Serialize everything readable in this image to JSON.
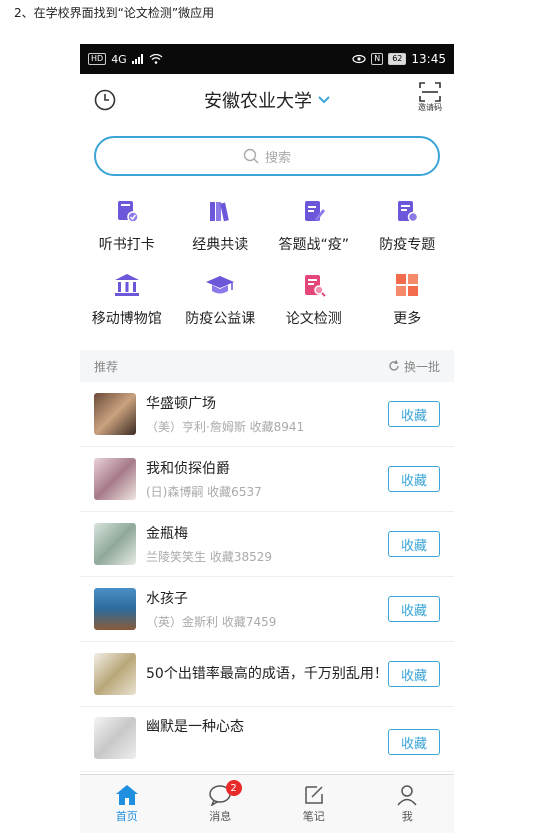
{
  "caption": "2、在学校界面找到“论文检测”微应用",
  "status_bar": {
    "network": "4G",
    "battery": "62",
    "time": "13:45"
  },
  "header": {
    "title": "安徽农业大学",
    "invite_label": "邀请码"
  },
  "search": {
    "placeholder": "搜索"
  },
  "apps": [
    {
      "label": "听书打卡",
      "icon": "audiobook-checkin-icon",
      "color": "#6c56d9"
    },
    {
      "label": "经典共读",
      "icon": "books-icon",
      "color": "#6c56d9"
    },
    {
      "label": "答题战“疫”",
      "icon": "quiz-icon",
      "color": "#6c56d9"
    },
    {
      "label": "防疫专题",
      "icon": "epidemic-topic-icon",
      "color": "#6c56d9"
    },
    {
      "label": "移动博物馆",
      "icon": "museum-icon",
      "color": "#6c56d9"
    },
    {
      "label": "防疫公益课",
      "icon": "graduation-cap-icon",
      "color": "#6c56d9"
    },
    {
      "label": "论文检测",
      "icon": "paper-check-icon",
      "color": "#e5467a"
    },
    {
      "label": "更多",
      "icon": "more-grid-icon",
      "color": "#f26b4a"
    }
  ],
  "recommend": {
    "title": "推荐",
    "refresh_label": "换一批",
    "items": [
      {
        "title": "华盛顿广场",
        "meta": "（美）亨利·詹姆斯  收藏8941",
        "action": "收藏"
      },
      {
        "title": "我和侦探伯爵",
        "meta": "(日)森博嗣  收藏6537",
        "action": "收藏"
      },
      {
        "title": "金瓶梅",
        "meta": "兰陵笑笑生  收藏38529",
        "action": "收藏"
      },
      {
        "title": "水孩子",
        "meta": "（英）金斯利  收藏7459",
        "action": "收藏"
      },
      {
        "title": "50个出错率最高的成语，千万别乱用！",
        "meta": "",
        "action": "收藏"
      },
      {
        "title": "幽默是一种心态",
        "meta": "",
        "action": "收藏"
      }
    ]
  },
  "tabs": [
    {
      "label": "首页",
      "icon": "home-icon",
      "active": true
    },
    {
      "label": "消息",
      "icon": "message-icon",
      "badge": "2"
    },
    {
      "label": "笔记",
      "icon": "note-icon"
    },
    {
      "label": "我",
      "icon": "profile-icon"
    }
  ],
  "colors": {
    "accent": "#3aa5d6",
    "tab_active": "#1f8fe0",
    "badge": "#e82a2a"
  }
}
